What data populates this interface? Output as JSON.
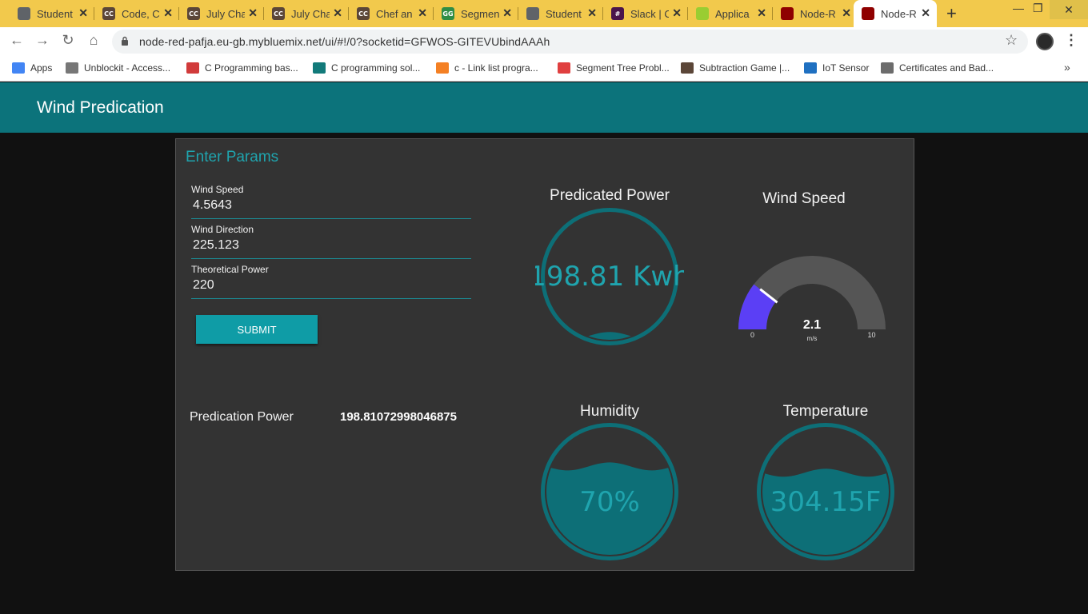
{
  "browser": {
    "tabs": [
      {
        "title": "Student",
        "icon_color": "#5f6368",
        "icon_text": ""
      },
      {
        "title": "Code, C",
        "icon_color": "#5b4638",
        "icon_text": "CC"
      },
      {
        "title": "July Cha",
        "icon_color": "#5b4638",
        "icon_text": "CC"
      },
      {
        "title": "July Cha",
        "icon_color": "#5b4638",
        "icon_text": "CC"
      },
      {
        "title": "Chef an",
        "icon_color": "#5b4638",
        "icon_text": "CC"
      },
      {
        "title": "Segmen",
        "icon_color": "#2f8d46",
        "icon_text": "GG"
      },
      {
        "title": "Student",
        "icon_color": "#5f6368",
        "icon_text": ""
      },
      {
        "title": "Slack | C",
        "icon_color": "#4a154b",
        "icon_text": "#"
      },
      {
        "title": "Applica",
        "icon_color": "#9acd32",
        "icon_text": ""
      },
      {
        "title": "Node-R",
        "icon_color": "#8f0000",
        "icon_text": ""
      },
      {
        "title": "Node-R",
        "icon_color": "#8f0000",
        "icon_text": ""
      }
    ],
    "active_tab_index": 10,
    "url": "node-red-pafja.eu-gb.mybluemix.net/ui/#!/0?socketid=GFWOS-GITEVUbindAAAh",
    "bookmarks": [
      {
        "label": "Apps",
        "icon_color": "#4285f4"
      },
      {
        "label": "Unblockit - Access...",
        "icon_color": "#777777"
      },
      {
        "label": "C Programming bas...",
        "icon_color": "#d13b3b"
      },
      {
        "label": "C programming sol...",
        "icon_color": "#127a7a"
      },
      {
        "label": "c - Link list progra...",
        "icon_color": "#f48024"
      },
      {
        "label": "Segment Tree Probl...",
        "icon_color": "#e03f3f"
      },
      {
        "label": "Subtraction Game |...",
        "icon_color": "#5b4638"
      },
      {
        "label": "IoT Sensor",
        "icon_color": "#1f70c1"
      },
      {
        "label": "Certificates and Bad...",
        "icon_color": "#6c6c6c"
      }
    ]
  },
  "app": {
    "title": "Wind Predication",
    "header_color": "#0c737b",
    "accent_color": "#1fa4ae"
  },
  "form": {
    "title": "Enter Params",
    "fields": [
      {
        "label": "Wind Speed",
        "value": "4.5643"
      },
      {
        "label": "Wind Direction",
        "value": "225.123"
      },
      {
        "label": "Theoretical Power",
        "value": "220"
      }
    ],
    "submit_label": "SUBMIT"
  },
  "prediction": {
    "label": "Predication Power",
    "value": "198.81072998046875"
  },
  "widgets": {
    "predicted_power": {
      "title": "Predicated Power",
      "display": "198.81 Kwh",
      "fill_fraction": 0.03
    },
    "wind_speed": {
      "title": "Wind Speed",
      "value": 2.1,
      "value_text": "2.1",
      "unit": "m/s",
      "min": 0,
      "max": 10,
      "min_text": "0",
      "max_text": "10",
      "needle_color": "#5b3ff5"
    },
    "humidity": {
      "title": "Humidity",
      "display": "70%",
      "fill_fraction": 0.7
    },
    "temperature": {
      "title": "Temperature",
      "display": "304.15F",
      "fill_fraction": 0.65
    }
  }
}
